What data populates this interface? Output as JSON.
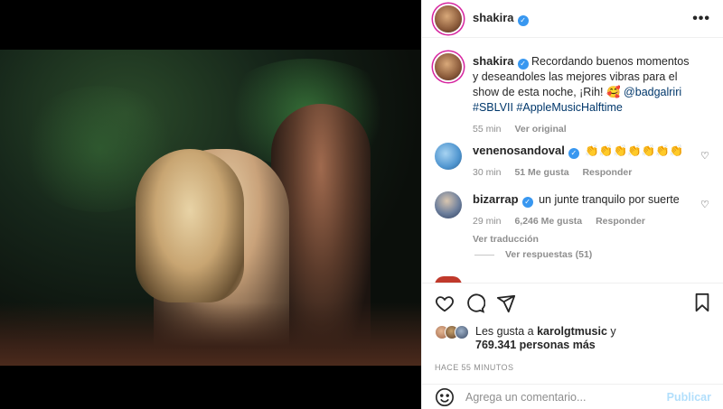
{
  "header": {
    "username": "shakira",
    "verified_icon": "verified-badge-icon",
    "more_icon": "more-options-icon",
    "more_label": "•••"
  },
  "caption": {
    "username": "shakira",
    "text": "Recordando buenos momentos y deseandoles las mejores vibras para el show de esta noche, ¡Rih! 🥰 ",
    "mention": "@badgalriri",
    "hashtags": [
      "#SBLVII",
      "#AppleMusicHalftime"
    ],
    "time": "55 min",
    "translation": "Ver original"
  },
  "comments": [
    {
      "username": "venenosandoval",
      "text": "👏👏👏👏👏👏👏",
      "time": "30 min",
      "likes": "51 Me gusta",
      "reply": "Responder",
      "avatar_color": "#5aa0d8"
    },
    {
      "username": "bizarrap",
      "text": "un junte tranquilo por suerte",
      "time": "29 min",
      "likes": "6,246 Me gusta",
      "reply": "Responder",
      "translation": "Ver traducción",
      "avatar_color": "#3b5c8a"
    }
  ],
  "replies": {
    "label": "Ver respuestas (51)"
  },
  "actions": {
    "like_icon": "heart-icon",
    "comment_icon": "comment-icon",
    "share_icon": "share-icon",
    "save_icon": "bookmark-icon"
  },
  "likes": {
    "prefix": "Les gusta a ",
    "user": "karolgtmusic",
    "joiner": " y",
    "others": "769.341 personas más"
  },
  "timestamp": "HACE 55 MINUTOS",
  "composer": {
    "placeholder": "Agrega un comentario...",
    "publish": "Publicar",
    "emoji_icon": "emoji-icon"
  },
  "colors": {
    "verified": "#3897f0",
    "link": "#00376b",
    "muted": "#8e8e8e",
    "publish_disabled": "#b2dffc"
  }
}
